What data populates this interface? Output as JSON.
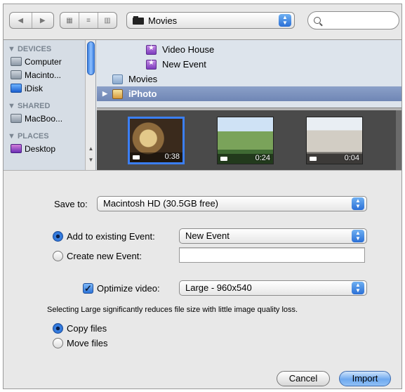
{
  "toolbar": {
    "back_icon": "back-arrow",
    "forward_icon": "forward-arrow",
    "view_icons": [
      "icon-view",
      "list-view",
      "column-view"
    ],
    "location": "Movies",
    "search_placeholder": ""
  },
  "sidebar": {
    "devices_header": "▼ DEVICES",
    "devices": [
      {
        "label": "Computer",
        "icon": "computer-icon"
      },
      {
        "label": "Macinto...",
        "icon": "hard-drive-icon"
      },
      {
        "label": "iDisk",
        "icon": "idisk-icon"
      }
    ],
    "shared_header": "▼ SHARED",
    "shared": [
      {
        "label": "MacBoo...",
        "icon": "computer-icon"
      }
    ],
    "places_header": "▼ PLACES",
    "places": [
      {
        "label": "Desktop",
        "icon": "desktop-icon"
      }
    ]
  },
  "files": [
    {
      "label": "Video House",
      "icon": "event-icon"
    },
    {
      "label": "New Event",
      "icon": "event-icon"
    },
    {
      "label": "Movies",
      "icon": "folder-icon"
    },
    {
      "label": "iPhoto",
      "icon": "iphoto-icon",
      "selected": true
    }
  ],
  "thumbnails": [
    {
      "duration": "0:38",
      "selected": true
    },
    {
      "duration": "0:24",
      "selected": false
    },
    {
      "duration": "0:04",
      "selected": false
    }
  ],
  "options": {
    "save_to_label": "Save to:",
    "save_to_value": "Macintosh HD (30.5GB free)",
    "add_existing_label": "Add to existing Event:",
    "add_existing_value": "New Event",
    "create_new_label": "Create new Event:",
    "create_new_value": "",
    "optimize_label": "Optimize video:",
    "optimize_value": "Large - 960x540",
    "hint": "Selecting Large significantly reduces file size with little image quality loss.",
    "copy_label": "Copy files",
    "move_label": "Move files"
  },
  "buttons": {
    "cancel": "Cancel",
    "import": "Import"
  },
  "colors": {
    "accent": "#3b7ff5",
    "sidebar_bg": "#d6dde5",
    "selected_row": "#7a8fbd"
  }
}
